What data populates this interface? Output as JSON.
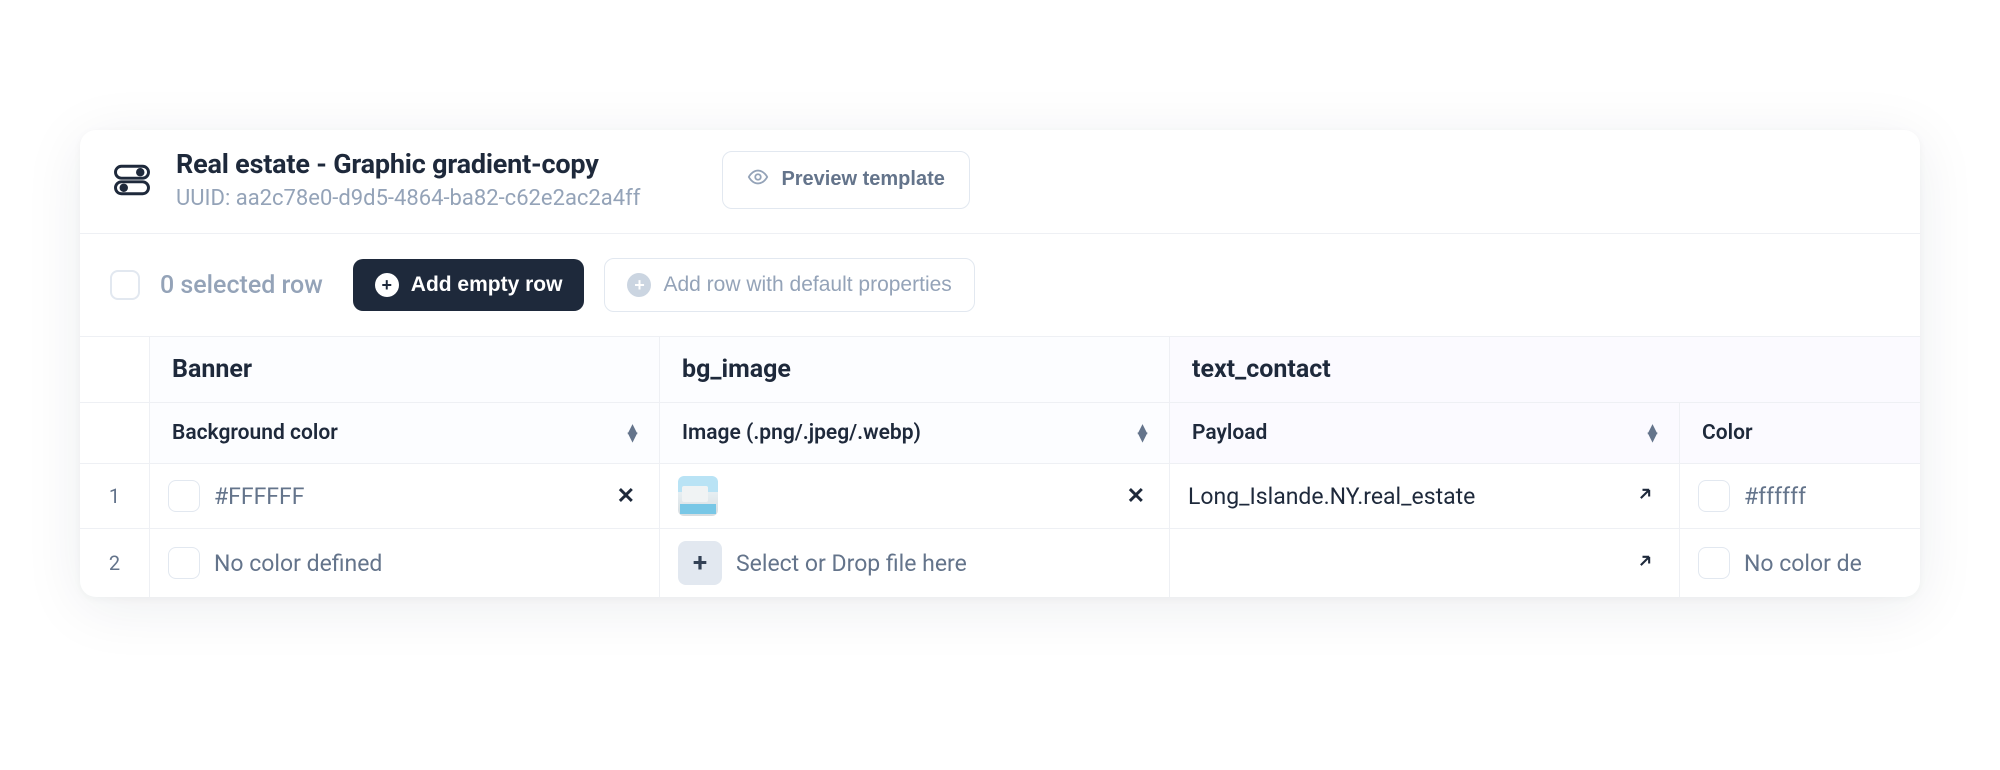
{
  "header": {
    "title": "Real estate - Graphic gradient-copy",
    "uuid_label": "UUID: aa2c78e0-d9d5-4864-ba82-c62e2ac2a4ff",
    "preview_label": "Preview template"
  },
  "toolbar": {
    "selected_text": "0 selected row",
    "add_empty_label": "Add empty row",
    "add_default_label": "Add row with default properties"
  },
  "columns": {
    "banner": {
      "group": "Banner",
      "sub": "Background color"
    },
    "bg_image": {
      "group": "bg_image",
      "sub": "Image (.png/.jpeg/.webp)"
    },
    "text_contact": {
      "group": "text_contact",
      "sub_payload": "Payload",
      "sub_color": "Color"
    }
  },
  "rows": [
    {
      "num": "1",
      "banner_value": "#FFFFFF",
      "bg_has_image": true,
      "bg_placeholder": "",
      "payload": "Long_Islande.NY.real_estate",
      "color_value": "#ffffff"
    },
    {
      "num": "2",
      "banner_value": "No color defined",
      "bg_has_image": false,
      "bg_placeholder": "Select or Drop file here",
      "payload": "",
      "color_value": "No color de"
    }
  ]
}
